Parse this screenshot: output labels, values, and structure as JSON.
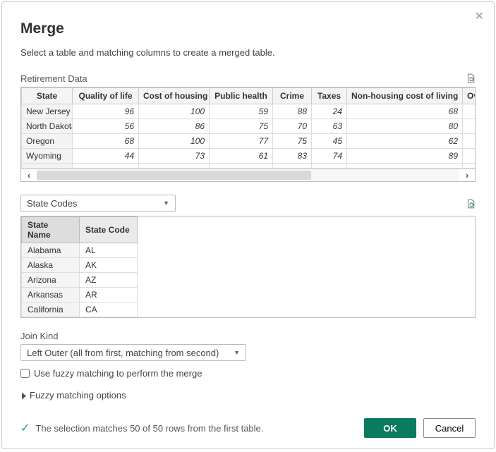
{
  "title": "Merge",
  "subtitle": "Select a table and matching columns to create a merged table.",
  "primary": {
    "name": "Retirement Data",
    "columns": [
      "State",
      "Quality of life",
      "Cost of housing",
      "Public health",
      "Crime",
      "Taxes",
      "Non-housing cost of living",
      "Ov"
    ],
    "rows": [
      {
        "state": "New Jersey",
        "vals": [
          96,
          100,
          59,
          88,
          24,
          68
        ]
      },
      {
        "state": "North Dakota",
        "vals": [
          56,
          86,
          75,
          70,
          63,
          80
        ]
      },
      {
        "state": "Oregon",
        "vals": [
          68,
          100,
          77,
          75,
          45,
          62
        ]
      },
      {
        "state": "Wyoming",
        "vals": [
          44,
          73,
          61,
          83,
          74,
          89
        ]
      }
    ]
  },
  "secondary": {
    "dropdown": "State Codes",
    "columns": [
      "State Name",
      "State Code"
    ],
    "rows": [
      {
        "name": "Alabama",
        "code": "AL"
      },
      {
        "name": "Alaska",
        "code": "AK"
      },
      {
        "name": "Arizona",
        "code": "AZ"
      },
      {
        "name": "Arkansas",
        "code": "AR"
      },
      {
        "name": "California",
        "code": "CA"
      }
    ]
  },
  "joinKind": {
    "label": "Join Kind",
    "value": "Left Outer (all from first, matching from second)"
  },
  "fuzzy": {
    "checkbox": "Use fuzzy matching to perform the merge",
    "expander": "Fuzzy matching options"
  },
  "status": "The selection matches 50 of 50 rows from the first table.",
  "buttons": {
    "ok": "OK",
    "cancel": "Cancel"
  }
}
